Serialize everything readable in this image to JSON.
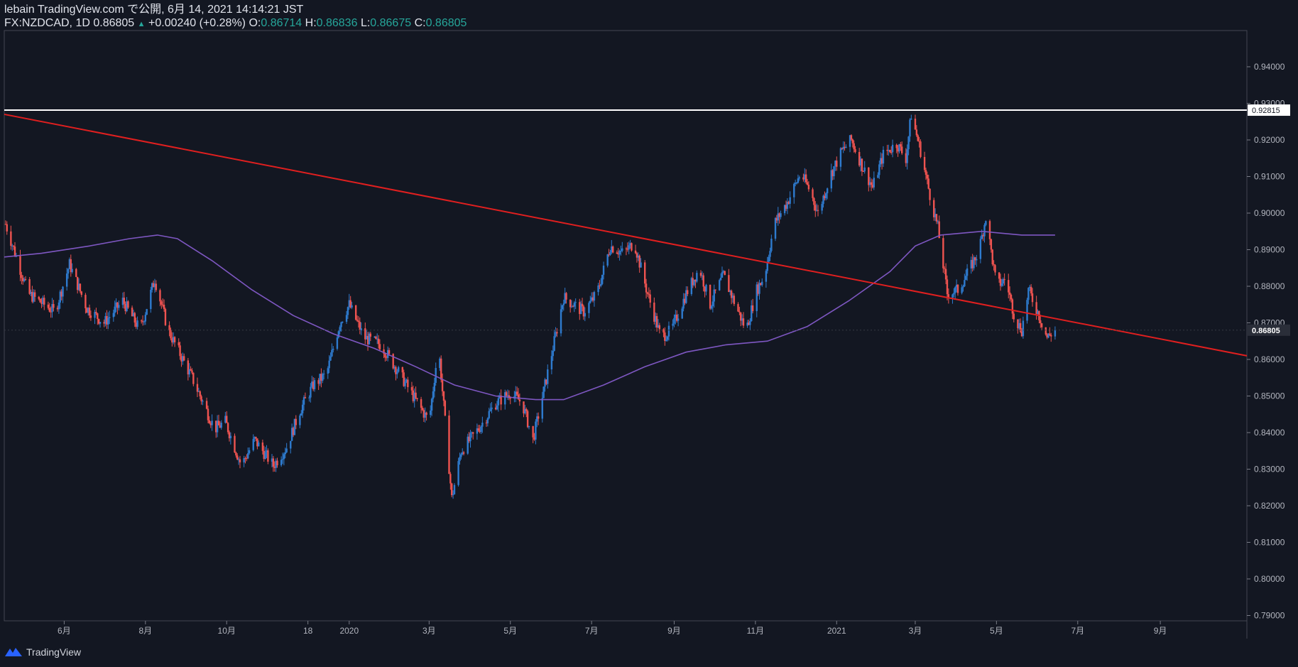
{
  "header": {
    "line1": "lebain TradingView.com で公開, 6月 14, 2021 14:14:21 JST",
    "symbol": "FX:NZDCAD, 1D",
    "last": "0.86805",
    "arrow": "▲",
    "change": "+0.00240 (+0.28%)",
    "o_label": "O:",
    "o_value": "0.86714",
    "h_label": "H:",
    "h_value": "0.86836",
    "l_label": "L:",
    "l_value": "0.86675",
    "c_label": "C:",
    "c_value": "0.86805"
  },
  "footer": {
    "brand": "TradingView"
  },
  "colors": {
    "background": "#131722",
    "up": "#2e7bcf",
    "down": "#ef5350",
    "ma": "#7e57c2",
    "trendline": "#e01f1f",
    "hline": "#ffffff"
  },
  "chart_data": {
    "type": "candlestick",
    "ylim": [
      0.79,
      0.94
    ],
    "y_ticks": [
      "0.94000",
      "0.93000",
      "0.92000",
      "0.91000",
      "0.90000",
      "0.89000",
      "0.88000",
      "0.87000",
      "0.86000",
      "0.85000",
      "0.84000",
      "0.83000",
      "0.82000",
      "0.81000",
      "0.80000",
      "0.79000"
    ],
    "x_ticks": [
      "6月",
      "8月",
      "10月",
      "18",
      "2020",
      "3月",
      "5月",
      "7月",
      "9月",
      "11月",
      "2021",
      "3月",
      "5月",
      "7月",
      "9月"
    ],
    "x_tick_dates": [
      "2019-06-01",
      "2019-08-01",
      "2019-10-01",
      "2019-12-01",
      "2020-01-01",
      "2020-03-01",
      "2020-05-01",
      "2020-07-01",
      "2020-09-01",
      "2020-11-01",
      "2021-01-01",
      "2021-03-01",
      "2021-05-01",
      "2021-07-01",
      "2021-09-01"
    ],
    "x_range": [
      "2019-04-17",
      "2021-11-05"
    ],
    "price_path": [
      [
        "2019-04-18",
        0.897
      ],
      [
        "2019-05-05",
        0.878
      ],
      [
        "2019-05-25",
        0.873
      ],
      [
        "2019-06-05",
        0.886
      ],
      [
        "2019-06-18",
        0.874
      ],
      [
        "2019-07-01",
        0.87
      ],
      [
        "2019-07-15",
        0.876
      ],
      [
        "2019-07-28",
        0.868
      ],
      [
        "2019-08-08",
        0.882
      ],
      [
        "2019-08-18",
        0.868
      ],
      [
        "2019-09-05",
        0.855
      ],
      [
        "2019-09-22",
        0.841
      ],
      [
        "2019-09-30",
        0.843
      ],
      [
        "2019-10-12",
        0.831
      ],
      [
        "2019-10-22",
        0.838
      ],
      [
        "2019-11-05",
        0.831
      ],
      [
        "2019-11-15",
        0.836
      ],
      [
        "2019-11-25",
        0.846
      ],
      [
        "2019-12-05",
        0.853
      ],
      [
        "2019-12-15",
        0.856
      ],
      [
        "2019-12-25",
        0.87
      ],
      [
        "2020-01-01",
        0.875
      ],
      [
        "2020-01-12",
        0.866
      ],
      [
        "2020-01-25",
        0.864
      ],
      [
        "2020-02-08",
        0.856
      ],
      [
        "2020-02-18",
        0.85
      ],
      [
        "2020-03-01",
        0.843
      ],
      [
        "2020-03-08",
        0.864
      ],
      [
        "2020-03-18",
        0.822
      ],
      [
        "2020-03-25",
        0.835
      ],
      [
        "2020-04-05",
        0.84
      ],
      [
        "2020-04-20",
        0.848
      ],
      [
        "2020-05-01",
        0.851
      ],
      [
        "2020-05-10",
        0.848
      ],
      [
        "2020-05-18",
        0.838
      ],
      [
        "2020-05-30",
        0.858
      ],
      [
        "2020-06-10",
        0.877
      ],
      [
        "2020-06-25",
        0.873
      ],
      [
        "2020-07-05",
        0.878
      ],
      [
        "2020-07-15",
        0.891
      ],
      [
        "2020-07-25",
        0.889
      ],
      [
        "2020-08-02",
        0.892
      ],
      [
        "2020-08-12",
        0.878
      ],
      [
        "2020-08-22",
        0.866
      ],
      [
        "2020-08-30",
        0.868
      ],
      [
        "2020-09-10",
        0.878
      ],
      [
        "2020-09-20",
        0.885
      ],
      [
        "2020-09-28",
        0.875
      ],
      [
        "2020-10-08",
        0.883
      ],
      [
        "2020-10-18",
        0.874
      ],
      [
        "2020-10-25",
        0.868
      ],
      [
        "2020-11-02",
        0.879
      ],
      [
        "2020-11-08",
        0.883
      ],
      [
        "2020-11-15",
        0.897
      ],
      [
        "2020-11-25",
        0.903
      ],
      [
        "2020-12-05",
        0.911
      ],
      [
        "2020-12-12",
        0.906
      ],
      [
        "2020-12-18",
        0.9
      ],
      [
        "2020-12-28",
        0.911
      ],
      [
        "2021-01-05",
        0.917
      ],
      [
        "2021-01-12",
        0.92
      ],
      [
        "2021-01-20",
        0.913
      ],
      [
        "2021-01-28",
        0.907
      ],
      [
        "2021-02-05",
        0.916
      ],
      [
        "2021-02-15",
        0.919
      ],
      [
        "2021-02-22",
        0.915
      ],
      [
        "2021-02-26",
        0.927
      ],
      [
        "2021-03-05",
        0.917
      ],
      [
        "2021-03-12",
        0.905
      ],
      [
        "2021-03-18",
        0.896
      ],
      [
        "2021-03-25",
        0.878
      ],
      [
        "2021-04-02",
        0.879
      ],
      [
        "2021-04-10",
        0.884
      ],
      [
        "2021-04-18",
        0.89
      ],
      [
        "2021-04-23",
        0.899
      ],
      [
        "2021-05-01",
        0.88
      ],
      [
        "2021-05-08",
        0.882
      ],
      [
        "2021-05-15",
        0.871
      ],
      [
        "2021-05-20",
        0.868
      ],
      [
        "2021-05-25",
        0.879
      ],
      [
        "2021-06-01",
        0.873
      ],
      [
        "2021-06-08",
        0.866
      ],
      [
        "2021-06-14",
        0.868
      ]
    ],
    "ma": [
      [
        "2019-04-17",
        0.888
      ],
      [
        "2019-05-15",
        0.889
      ],
      [
        "2019-06-20",
        0.891
      ],
      [
        "2019-07-20",
        0.893
      ],
      [
        "2019-08-10",
        0.894
      ],
      [
        "2019-08-25",
        0.893
      ],
      [
        "2019-09-20",
        0.887
      ],
      [
        "2019-10-20",
        0.879
      ],
      [
        "2019-11-20",
        0.872
      ],
      [
        "2019-12-20",
        0.867
      ],
      [
        "2020-01-20",
        0.863
      ],
      [
        "2020-02-20",
        0.858
      ],
      [
        "2020-03-20",
        0.853
      ],
      [
        "2020-04-20",
        0.85
      ],
      [
        "2020-05-20",
        0.849
      ],
      [
        "2020-06-10",
        0.849
      ],
      [
        "2020-07-10",
        0.853
      ],
      [
        "2020-08-10",
        0.858
      ],
      [
        "2020-09-10",
        0.862
      ],
      [
        "2020-10-10",
        0.864
      ],
      [
        "2020-11-10",
        0.865
      ],
      [
        "2020-12-10",
        0.869
      ],
      [
        "2021-01-10",
        0.876
      ],
      [
        "2021-02-10",
        0.884
      ],
      [
        "2021-03-01",
        0.891
      ],
      [
        "2021-03-20",
        0.894
      ],
      [
        "2021-04-20",
        0.895
      ],
      [
        "2021-05-20",
        0.894
      ],
      [
        "2021-06-14",
        0.894
      ]
    ],
    "trendline": [
      [
        "2019-04-17",
        0.927
      ],
      [
        "2021-11-05",
        0.861
      ]
    ],
    "hline": {
      "value": 0.92815,
      "label": "0.92815"
    },
    "last_price_label": "0.86805"
  }
}
